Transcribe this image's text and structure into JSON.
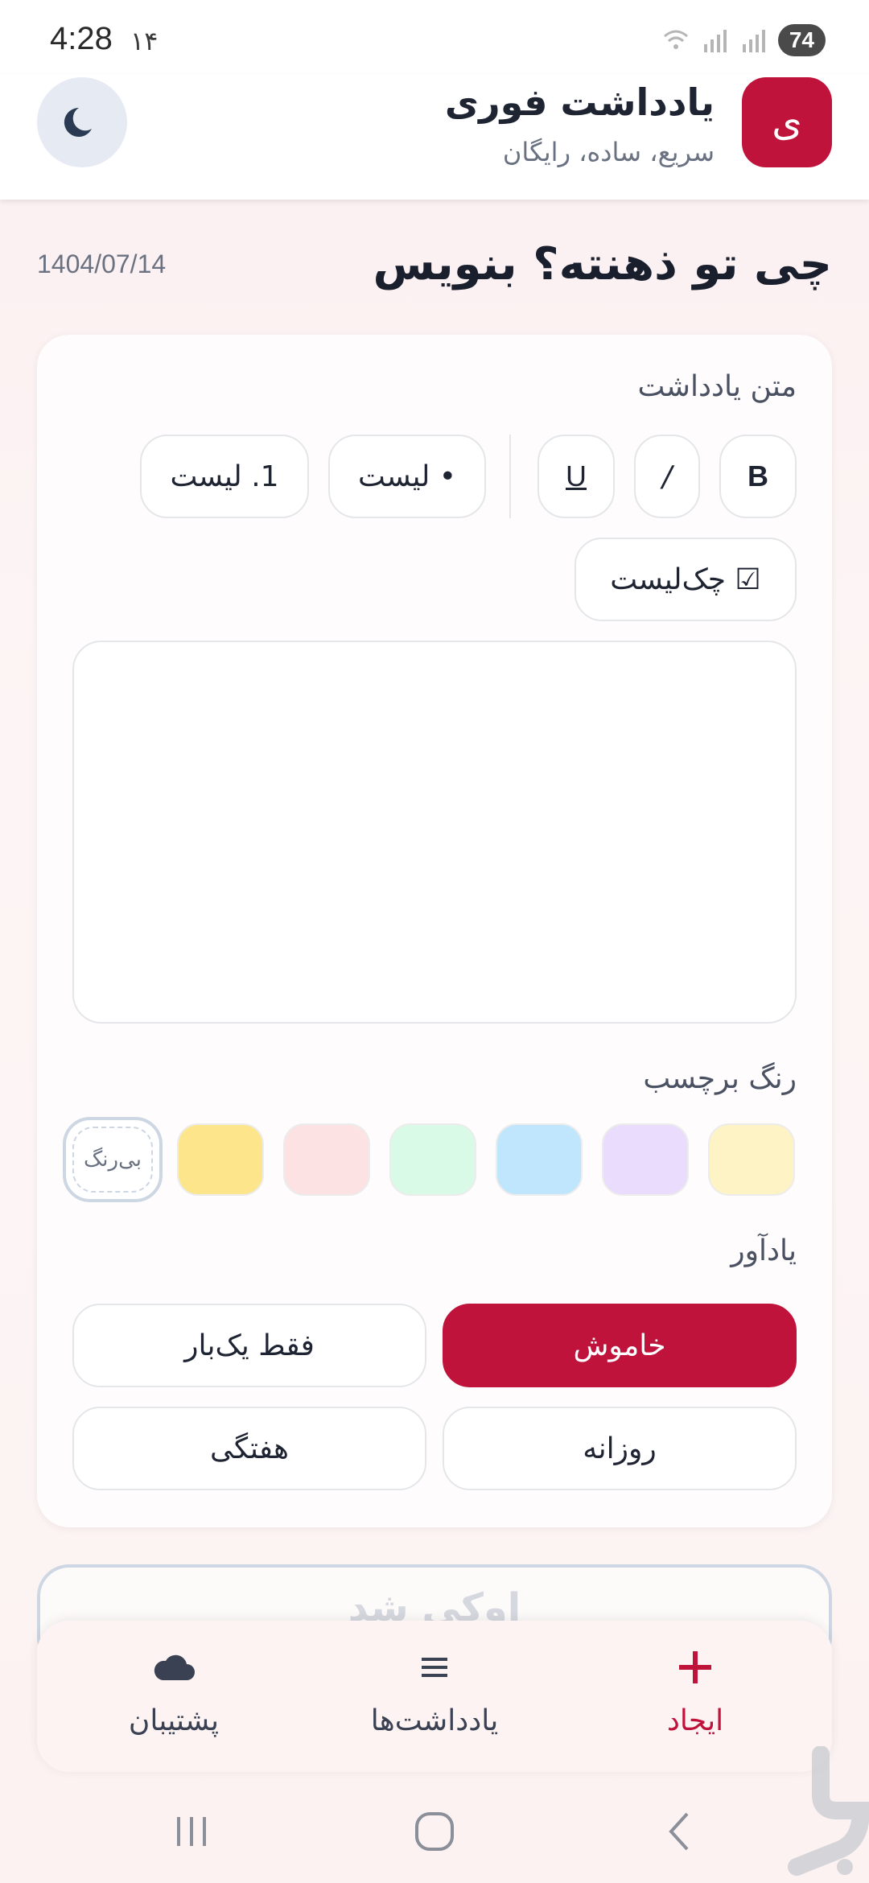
{
  "status_bar": {
    "time": "4:28",
    "extra": "۱۴",
    "battery": "74"
  },
  "header": {
    "logo_letter": "ی",
    "title": "یادداشت فوری",
    "subtitle": "سریع، ساده، رایگان",
    "theme_toggle_icon": "moon-icon"
  },
  "page": {
    "heading": "چی تو ذهنته؟ بنویس",
    "date": "1404/07/14"
  },
  "editor": {
    "label": "متن یادداشت",
    "toolbar": {
      "bold": "B",
      "italic": "/",
      "underline": "U",
      "bullet_list": "• لیست",
      "numbered_list": "1. لیست",
      "checklist": "☑ چک‌لیست"
    },
    "text_value": ""
  },
  "label_color": {
    "label": "رنگ برچسب",
    "swatches": [
      "#fdf3c4",
      "#eadcfd",
      "#bfe6fd",
      "#d9fae6",
      "#fde2e4",
      "#fde58c"
    ],
    "none_label": "بی‌رنگ",
    "selected": "none"
  },
  "reminder": {
    "label": "یادآور",
    "options": [
      "خاموش",
      "فقط یک‌بار",
      "روزانه",
      "هفتگی"
    ],
    "selected": "خاموش"
  },
  "save_button": {
    "label": "اوکی شد"
  },
  "bottom_nav": {
    "items": [
      {
        "label": "ایجاد",
        "icon": "plus-icon",
        "active": true
      },
      {
        "label": "یادداشت‌ها",
        "icon": "list-icon",
        "active": false
      },
      {
        "label": "پشتیبان",
        "icon": "cloud-icon",
        "active": false
      }
    ]
  },
  "colors": {
    "accent": "#c0133c",
    "text": "#1f2433",
    "muted": "#6a7282"
  }
}
